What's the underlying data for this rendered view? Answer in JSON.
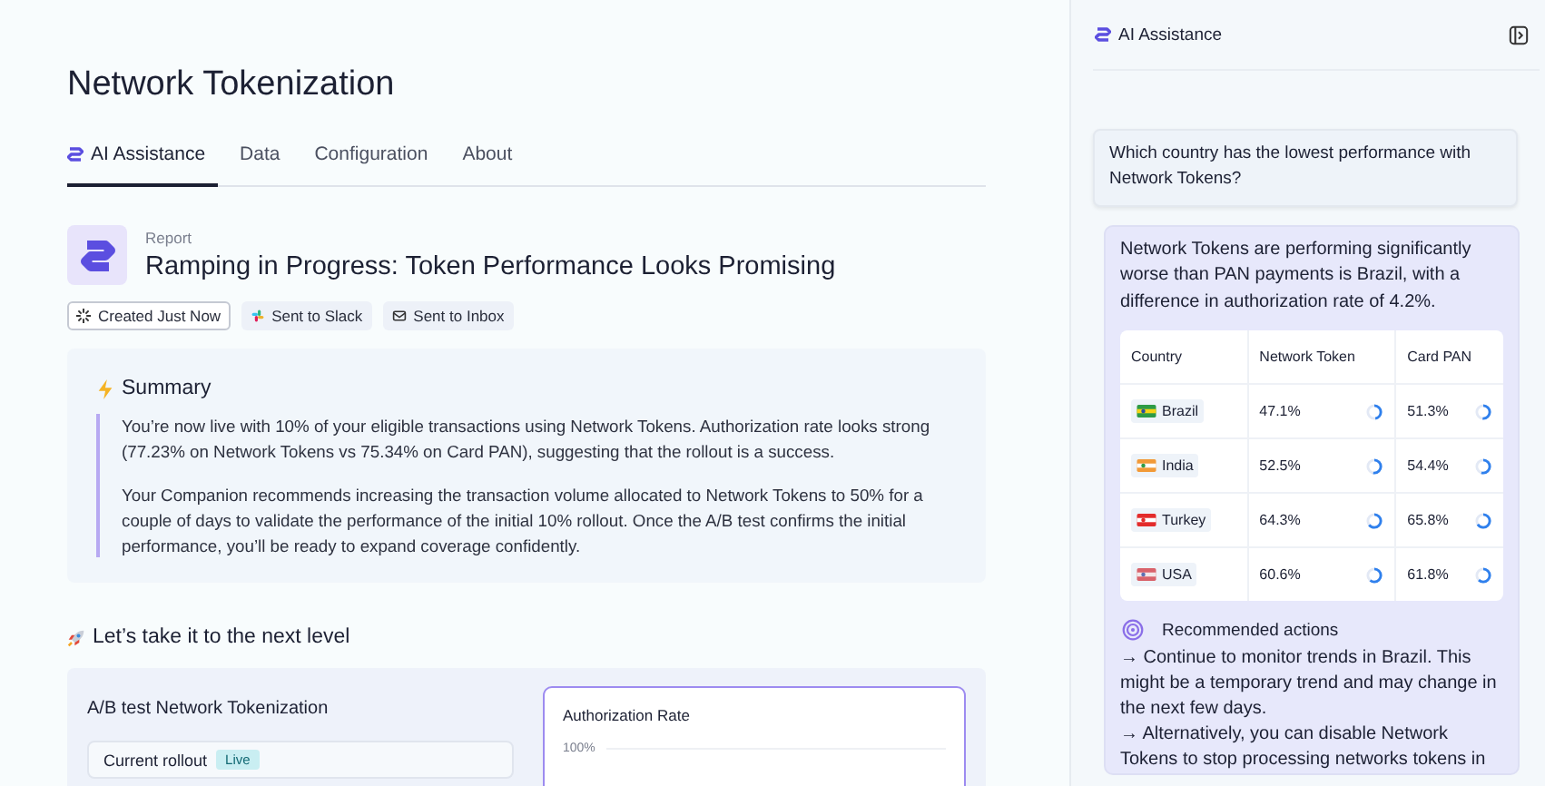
{
  "page": {
    "title": "Network Tokenization"
  },
  "tabs": [
    {
      "label": "AI Assistance",
      "selected": true,
      "kind": "ai"
    },
    {
      "label": "Data",
      "selected": false,
      "kind": "plain"
    },
    {
      "label": "Configuration",
      "selected": false,
      "kind": "plain"
    },
    {
      "label": "About",
      "selected": false,
      "kind": "plain"
    }
  ],
  "report": {
    "eyebrow": "Report",
    "title": "Ramping in Progress: Token Performance Looks Promising",
    "tags": [
      {
        "kind": "created",
        "label": "Created Just Now"
      },
      {
        "kind": "slack",
        "label": "Sent to Slack"
      },
      {
        "kind": "inbox",
        "label": "Sent to Inbox"
      }
    ]
  },
  "summary": {
    "heading": "Summary",
    "paragraphs": [
      "You’re now live with 10% of your eligible transactions using Network Tokens. Authorization rate looks strong (77.23% on Network Tokens vs 75.34% on Card PAN), suggesting that the rollout is a success.",
      "Your Companion recommends increasing the transaction volume allocated to Network Tokens to 50% for a couple of days to validate the performance of the initial 10% rollout. Once the A/B test confirms the initial performance, you’ll be ready to expand coverage confidently."
    ]
  },
  "next_level": {
    "heading": "Let’s take it to the next level",
    "card_title": "A/B test Network Tokenization",
    "rollout_label": "Current rollout",
    "rollout_badge": "Live",
    "chart_title": "Authorization Rate",
    "chart_tick": "100%"
  },
  "assistant": {
    "title": "AI Assistance",
    "question": "Which country has the lowest performance with Network Tokens?",
    "answer": "Network Tokens are performing significantly worse than PAN payments is Brazil, with a difference in authorization rate of 4.2%.",
    "table": {
      "columns": [
        "Country",
        "Network Token",
        "Card PAN"
      ],
      "rows": [
        {
          "kind": "brazil",
          "country": "Brazil",
          "network_token": {
            "value": "47.1%",
            "level": 0.471
          },
          "card_pan": {
            "value": "51.3%",
            "level": 0.513
          }
        },
        {
          "kind": "india",
          "country": "India",
          "network_token": {
            "value": "52.5%",
            "level": 0.525
          },
          "card_pan": {
            "value": "54.4%",
            "level": 0.544
          }
        },
        {
          "kind": "turkey",
          "country": "Turkey",
          "network_token": {
            "value": "64.3%",
            "level": 0.643
          },
          "card_pan": {
            "value": "65.8%",
            "level": 0.658
          }
        },
        {
          "kind": "usa",
          "country": "USA",
          "network_token": {
            "value": "60.6%",
            "level": 0.606
          },
          "card_pan": {
            "value": "61.8%",
            "level": 0.618
          }
        }
      ]
    },
    "actions_title": "Recommended actions",
    "actions": [
      "→ Continue to monitor trends in Brazil. This might be a temporary trend and may change in the next few days.",
      "→ Alternatively, you can disable Network Tokens to stop processing networks tokens in"
    ]
  }
}
